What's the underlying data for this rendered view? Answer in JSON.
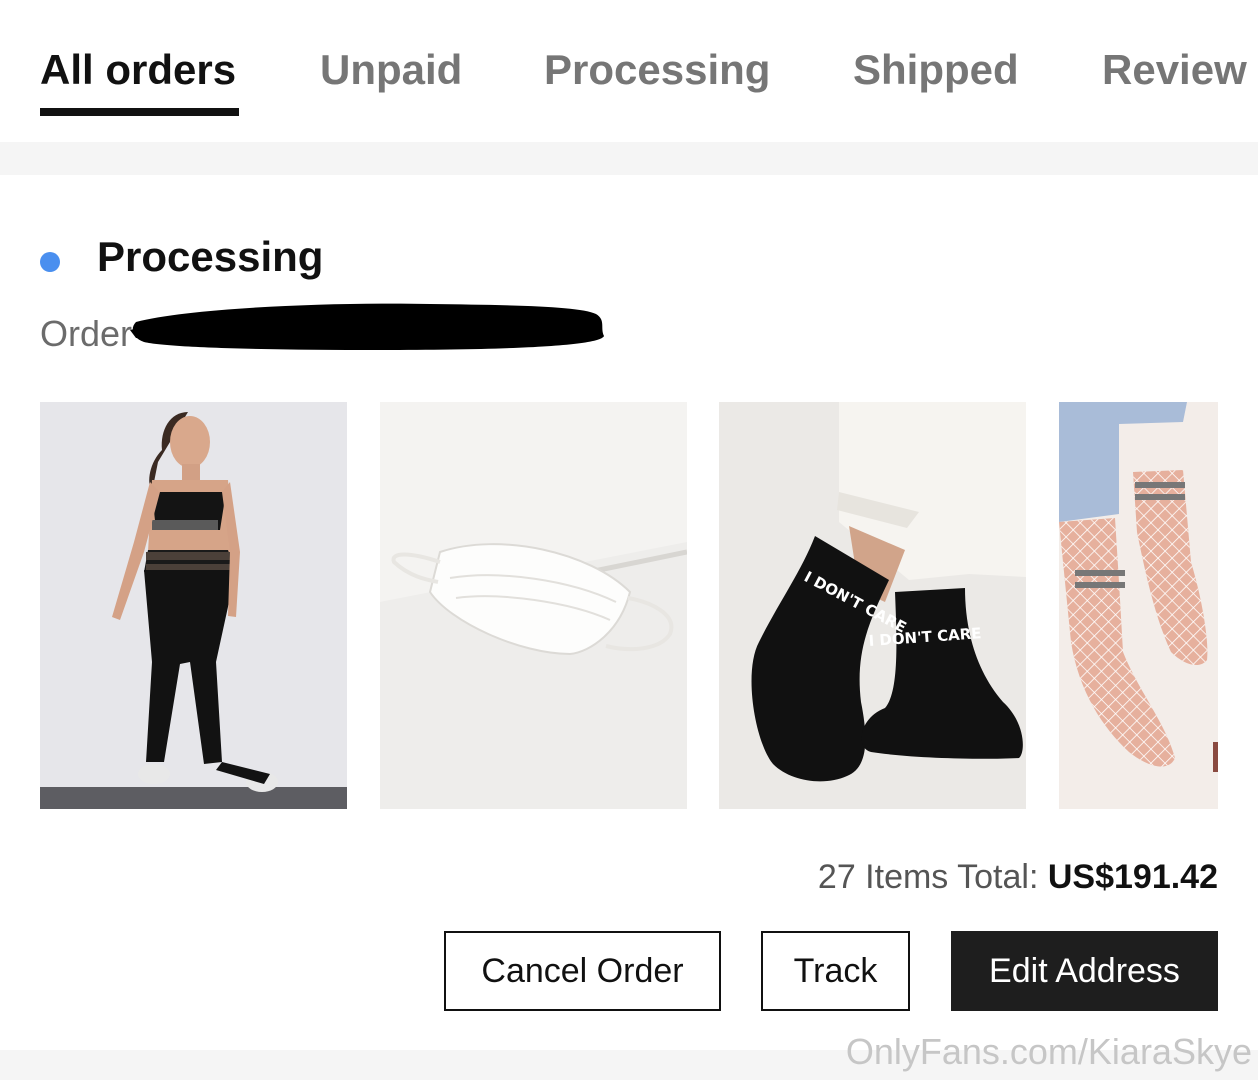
{
  "tabs": [
    {
      "label": "All orders",
      "active": true
    },
    {
      "label": "Unpaid",
      "active": false
    },
    {
      "label": "Processing",
      "active": false
    },
    {
      "label": "Shipped",
      "active": false
    },
    {
      "label": "Review",
      "active": false
    }
  ],
  "order": {
    "status": "Processing",
    "status_color": "#4a8fef",
    "order_label": "Order",
    "products": [
      {
        "name": "sports-bra-leggings-set"
      },
      {
        "name": "white-face-mask"
      },
      {
        "name": "black-socks"
      },
      {
        "name": "fishnet-socks"
      }
    ],
    "sock_text": "I DON'T CARE",
    "total": {
      "prefix": "27 Items Total: ",
      "amount": "US$191.42"
    },
    "actions": {
      "cancel": "Cancel Order",
      "track": "Track",
      "edit_address": "Edit Address"
    }
  },
  "watermark": "OnlyFans.com/KiaraSkye",
  "colors": {
    "active_tab": "#111111",
    "inactive_tab": "#767676",
    "primary_button": "#1e1e1e"
  }
}
